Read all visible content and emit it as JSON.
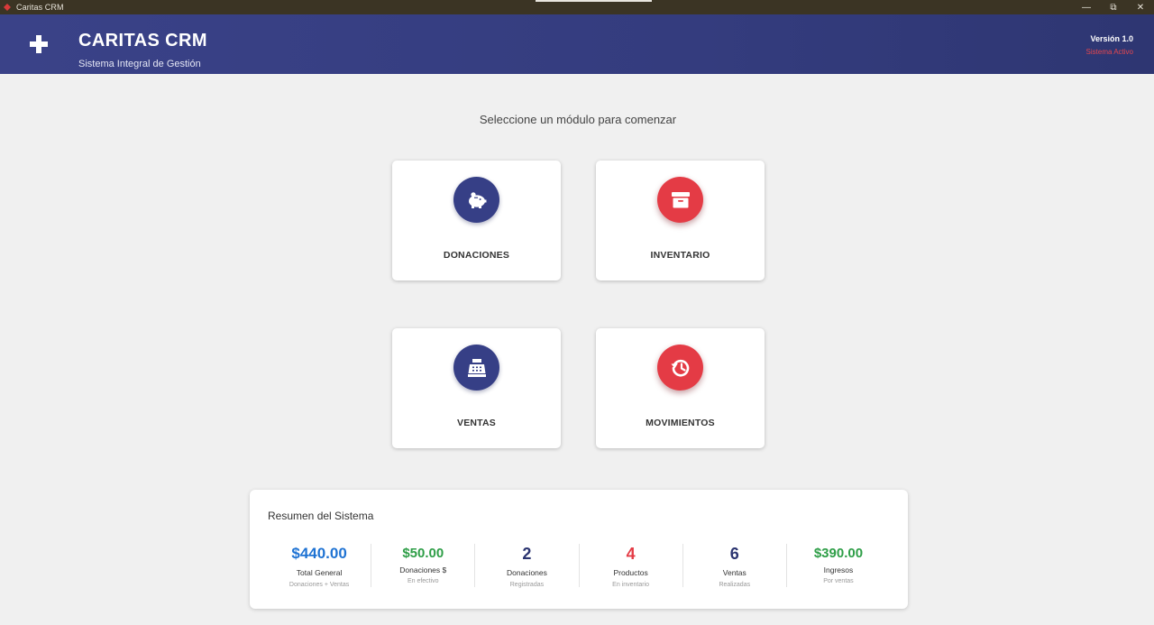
{
  "window": {
    "title": "Caritas CRM",
    "controls": {
      "minimize": "—",
      "restore": "⧉",
      "close": "✕"
    }
  },
  "header": {
    "brand": "CARITAS CRM",
    "subtitle": "Sistema Integral de Gestión",
    "version": "Versión 1.0",
    "status": "Sistema Activo",
    "logo_icon": "plus-icon"
  },
  "prompt": "Seleccione un módulo para comenzar",
  "modules": [
    {
      "label": "DONACIONES",
      "icon": "piggy-bank-icon",
      "color": "#363f86"
    },
    {
      "label": "INVENTARIO",
      "icon": "archive-box-icon",
      "color": "#e43b45"
    },
    {
      "label": "VENTAS",
      "icon": "cash-register-icon",
      "color": "#363f86"
    },
    {
      "label": "MOVIMIENTOS",
      "icon": "history-icon",
      "color": "#e43b45"
    }
  ],
  "summary": {
    "title": "Resumen del Sistema",
    "stats": [
      {
        "value": "$440.00",
        "label": "Total General",
        "sub": "Donaciones + Ventas",
        "color": "#1f73d3"
      },
      {
        "value": "$50.00",
        "label": "Donaciones $",
        "sub": "En efectivo",
        "color": "#2e9e47"
      },
      {
        "value": "2",
        "label": "Donaciones",
        "sub": "Registradas",
        "color": "#2b3470"
      },
      {
        "value": "4",
        "label": "Productos",
        "sub": "En inventario",
        "color": "#e43b45"
      },
      {
        "value": "6",
        "label": "Ventas",
        "sub": "Realizadas",
        "color": "#2b3470"
      },
      {
        "value": "$390.00",
        "label": "Ingresos",
        "sub": "Por ventas",
        "color": "#2e9e47"
      }
    ]
  }
}
